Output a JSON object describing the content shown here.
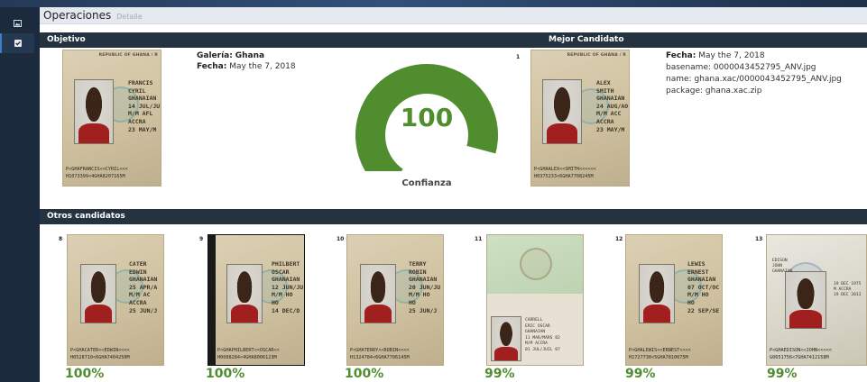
{
  "page": {
    "title": "Operaciones",
    "subtitle": "Detalle"
  },
  "sidebar": {
    "items": [
      {
        "icon": "image-icon"
      },
      {
        "icon": "checkbox-icon"
      }
    ]
  },
  "objetivo": {
    "header": "Objetivo",
    "gallery_label": "Galería:",
    "gallery_value": "Ghana",
    "date_label": "Fecha:",
    "date_value": "May the 7, 2018",
    "document": {
      "header": "REPUBLIC OF GHANA / R",
      "fields": [
        "FRANCIS",
        "CYRIL",
        "GHANAIAN",
        "14 JUL/JU",
        "M/M  AFL",
        "ACCRA",
        "23 MAY/M"
      ],
      "mrz": [
        "P<GHAFRANCIS<<CYRIL<<<",
        "H1073399<4GHA8207165M"
      ]
    }
  },
  "gauge": {
    "value": "100",
    "percent": 100,
    "label": "Confianza",
    "color": "#4f8d2f"
  },
  "mejor": {
    "header": "Mejor Candidato",
    "rank": "1",
    "date_label": "Fecha:",
    "date_value": "May the 7, 2018",
    "basename_label": "basename:",
    "basename_value": "0000043452795_ANV.jpg",
    "name_label": "name:",
    "name_value": "ghana.xac/0000043452795_ANV.jpg",
    "package_label": "package:",
    "package_value": "ghana.xac.zip",
    "document": {
      "header": "REPUBLIC OF GHANA / R",
      "fields": [
        "ALEX",
        "SMITH",
        "GHANAIAN",
        "24 AUG/AO",
        "M/M  ACC",
        "ACCRA",
        "23 MAY/M"
      ],
      "mrz": [
        "P<GHAALEX<<SMITH<<<<<<",
        "H0375233<6GHA7708245M"
      ]
    }
  },
  "otros": {
    "header": "Otros candidatos",
    "candidates": [
      {
        "rank": "8",
        "percent": "100%",
        "dark": false,
        "fields": [
          "CATER",
          "EDWIN",
          "GHANAIAN",
          "25 APR/A",
          "M/M  AC",
          "ACCRA",
          "25 JUN/J"
        ],
        "mrz": [
          "P<GHACATER<<EDWIN<<<<",
          "H0528710<6GHA7404250M"
        ]
      },
      {
        "rank": "9",
        "percent": "100%",
        "dark": true,
        "fields": [
          "PHILBERT",
          "OSCAR",
          "GHANAIAN",
          "12 JUN/JU",
          "M/M  HO",
          "HO",
          "14 DEC/D"
        ],
        "mrz": [
          "P<GHAPHILBERT<<OSCAR<<",
          "H0088284<4GHA8006123M"
        ]
      },
      {
        "rank": "10",
        "percent": "100%",
        "dark": false,
        "fields": [
          "TERRY",
          "ROBIN",
          "GHANAIAN",
          "20 JUN/JU",
          "M/M  HO",
          "HO",
          "25 JUN/J"
        ],
        "mrz": [
          "P<GHATERRY<<ROBIN<<<<",
          "H1324784<6GHA7706145M"
        ]
      },
      {
        "rank": "11",
        "percent": "99%",
        "dark": false,
        "green": true,
        "fields": [
          "CARRELL",
          "ERIC OSCAR",
          "GHANAIAN",
          "11 MAR/MARS 82",
          "M/M  ACCRA",
          "01 JUL/JUIL 07"
        ],
        "mrz": []
      },
      {
        "rank": "12",
        "percent": "99%",
        "dark": false,
        "fields": [
          "LEWIS",
          "ERNEST",
          "GHANAIAN",
          "07 OCT/OC",
          "M/M  HO",
          "HO",
          "22 SEP/SE"
        ],
        "mrz": [
          "P<GHALEWIS<<ERNEST<<<<",
          "H1727730<5GHA7810075M"
        ]
      },
      {
        "rank": "13",
        "percent": "99%",
        "dark": false,
        "blue": true,
        "fields": [
          "EDISON",
          "JOHN",
          "GHANAIAN",
          "19 DEC 1975",
          "M  ACCRA",
          "19 DEC 2013"
        ],
        "mrz": [
          "P<GHAEDISON<<JOHN<<<<<",
          "G0651756<7GHA7412158M"
        ]
      }
    ]
  }
}
